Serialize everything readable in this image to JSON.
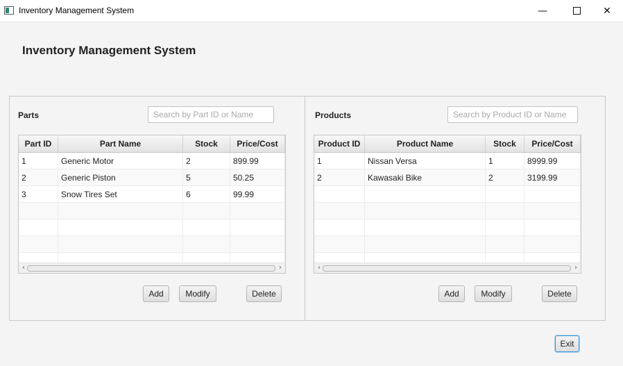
{
  "window": {
    "title": "Inventory Management System",
    "min_icon": "minimize-icon",
    "max_icon": "maximize-icon",
    "close_icon": "close-icon",
    "min_glyph": "—",
    "close_glyph": "✕"
  },
  "heading": "Inventory Management System",
  "parts": {
    "title": "Parts",
    "search_placeholder": "Search by Part ID or Name",
    "search_value": "",
    "columns": [
      "Part ID",
      "Part Name",
      "Stock",
      "Price/Cost"
    ],
    "rows": [
      [
        "1",
        "Generic Motor",
        "2",
        "899.99"
      ],
      [
        "2",
        "Generic Piston",
        "5",
        "50.25"
      ],
      [
        "3",
        "Snow Tires Set",
        "6",
        "99.99"
      ]
    ],
    "buttons": {
      "add": "Add",
      "modify": "Modify",
      "delete": "Delete"
    }
  },
  "products": {
    "title": "Products",
    "search_placeholder": "Search by Product ID or Name",
    "search_value": "",
    "columns": [
      "Product ID",
      "Product Name",
      "Stock",
      "Price/Cost"
    ],
    "rows": [
      [
        "1",
        "Nissan Versa",
        "1",
        "8999.99"
      ],
      [
        "2",
        "Kawasaki Bike",
        "2",
        "3199.99"
      ]
    ],
    "buttons": {
      "add": "Add",
      "modify": "Modify",
      "delete": "Delete"
    }
  },
  "scroll": {
    "left_glyph": "‹",
    "right_glyph": "›"
  },
  "exit_label": "Exit",
  "colors": {
    "focus_accent": "#3a95d8",
    "background": "#f4f4f4"
  }
}
